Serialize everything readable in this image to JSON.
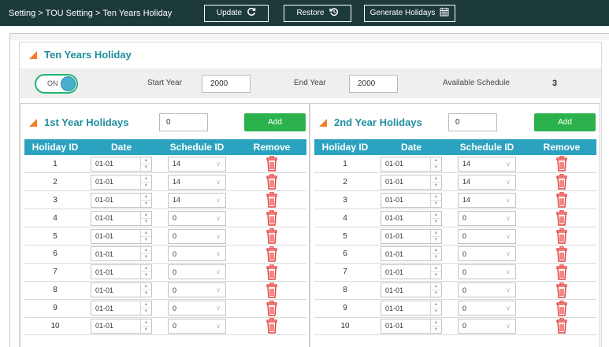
{
  "topbar": {
    "breadcrumb": "Setting > TOU Setting > Ten Years Holiday",
    "update_label": "Update",
    "restore_label": "Restore",
    "generate_label": "Generate Holidays"
  },
  "ten_years": {
    "title": "Ten Years Holiday",
    "toggle_label": "ON",
    "toggle_on": true,
    "start_year_label": "Start Year",
    "start_year_value": "2000",
    "end_year_label": "End Year",
    "end_year_value": "2000",
    "available_label": "Available Schedule",
    "available_value": "3"
  },
  "panels": [
    {
      "title": "1st Year Holidays",
      "count_value": "0",
      "add_label": "Add",
      "columns": [
        "Holiday ID",
        "Date",
        "Schedule ID",
        "Remove"
      ],
      "rows": [
        {
          "id": "1",
          "date": "01-01",
          "schedule": "14"
        },
        {
          "id": "2",
          "date": "01-01",
          "schedule": "14"
        },
        {
          "id": "3",
          "date": "01-01",
          "schedule": "14"
        },
        {
          "id": "4",
          "date": "01-01",
          "schedule": "0"
        },
        {
          "id": "5",
          "date": "01-01",
          "schedule": "0"
        },
        {
          "id": "6",
          "date": "01-01",
          "schedule": "0"
        },
        {
          "id": "7",
          "date": "01-01",
          "schedule": "0"
        },
        {
          "id": "8",
          "date": "01-01",
          "schedule": "0"
        },
        {
          "id": "9",
          "date": "01-01",
          "schedule": "0"
        },
        {
          "id": "10",
          "date": "01-01",
          "schedule": "0"
        }
      ]
    },
    {
      "title": "2nd Year Holidays",
      "count_value": "0",
      "add_label": "Add",
      "columns": [
        "Holiday ID",
        "Date",
        "Schedule ID",
        "Remove"
      ],
      "rows": [
        {
          "id": "1",
          "date": "01-01",
          "schedule": "14"
        },
        {
          "id": "2",
          "date": "01-01",
          "schedule": "14"
        },
        {
          "id": "3",
          "date": "01-01",
          "schedule": "14"
        },
        {
          "id": "4",
          "date": "01-01",
          "schedule": "0"
        },
        {
          "id": "5",
          "date": "01-01",
          "schedule": "0"
        },
        {
          "id": "6",
          "date": "01-01",
          "schedule": "0"
        },
        {
          "id": "7",
          "date": "01-01",
          "schedule": "0"
        },
        {
          "id": "8",
          "date": "01-01",
          "schedule": "0"
        },
        {
          "id": "9",
          "date": "01-01",
          "schedule": "0"
        },
        {
          "id": "10",
          "date": "01-01",
          "schedule": "0"
        }
      ]
    }
  ],
  "icons": {
    "update": "refresh-icon",
    "restore": "restore-history-icon",
    "generate": "calendar-icon",
    "remove": "trash-icon",
    "section": "orange-triangle-icon"
  },
  "colors": {
    "topbar_bg": "#1d3a3a",
    "accent_title": "#1e8e9e",
    "table_header": "#2ba2bf",
    "add_button": "#2bb24c",
    "trash": "#e53935",
    "triangle": "#f08020",
    "toggle_border": "#22b573"
  }
}
